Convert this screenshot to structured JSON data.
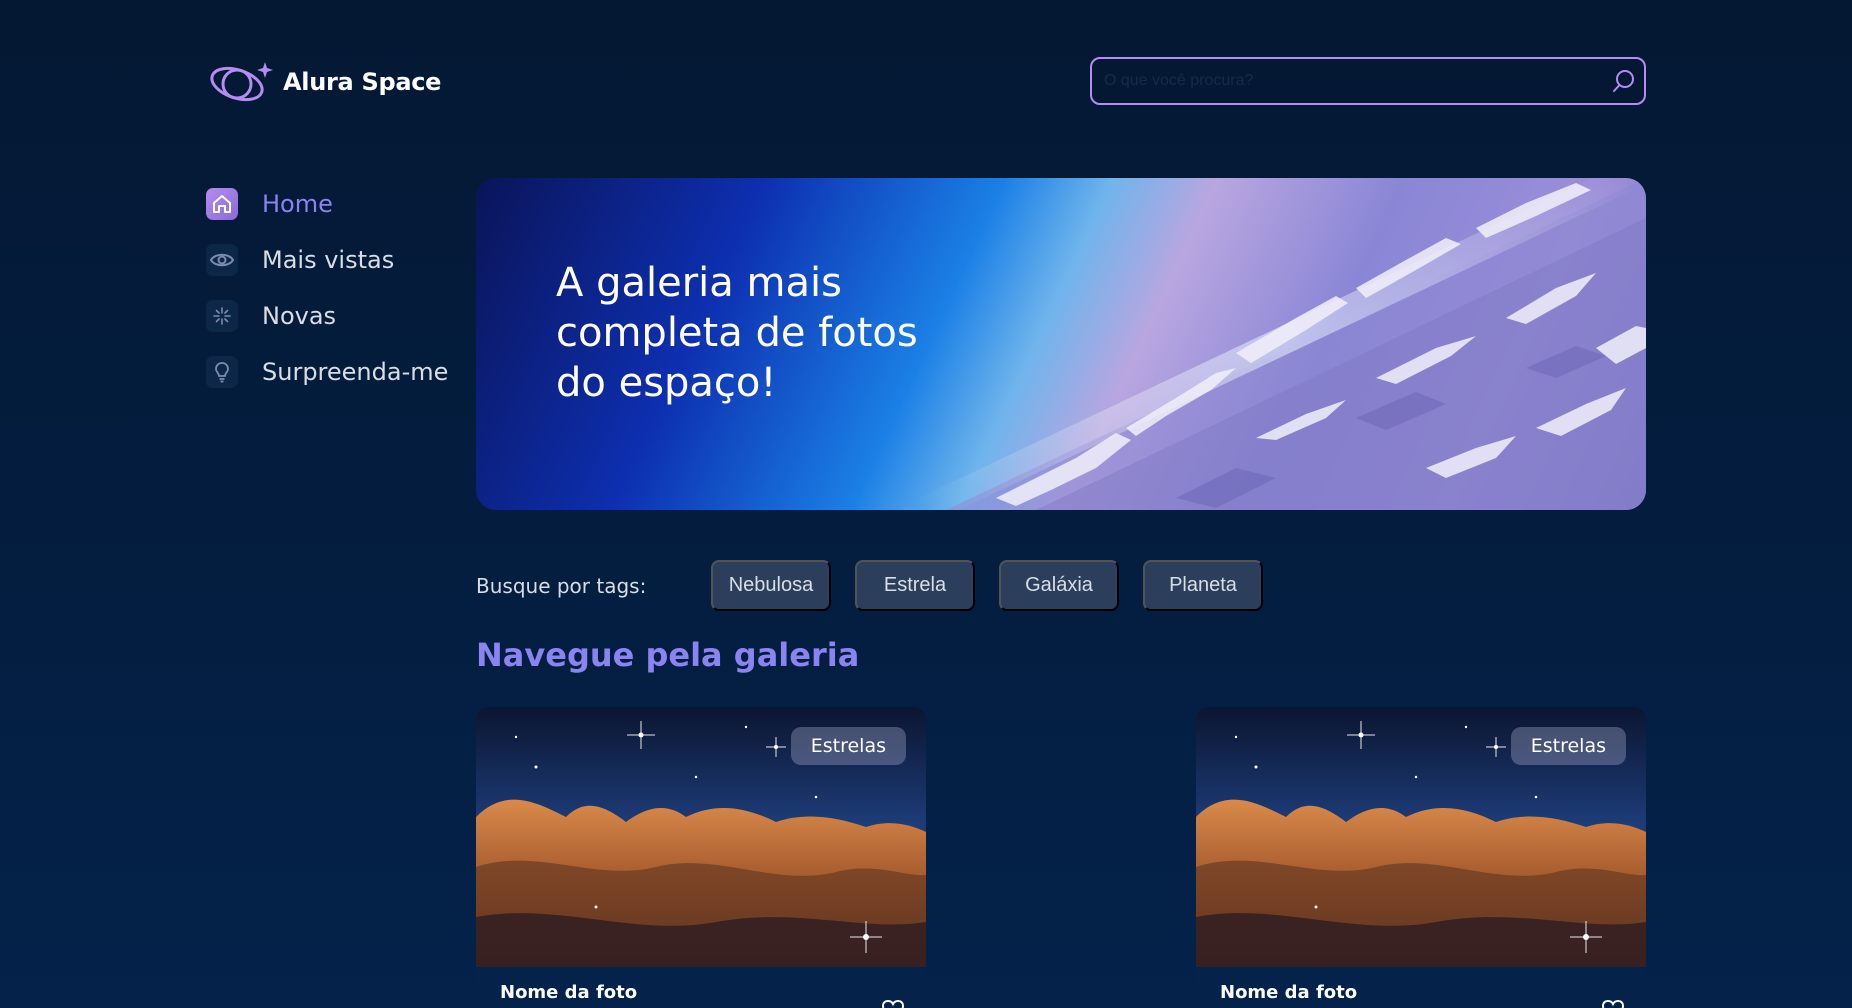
{
  "header": {
    "logo_text": "Alura Space",
    "search_placeholder": "O que você procura?"
  },
  "sidebar": {
    "items": [
      {
        "label": "Home",
        "icon": "home-icon",
        "active": true
      },
      {
        "label": "Mais vistas",
        "icon": "eye-icon",
        "active": false
      },
      {
        "label": "Novas",
        "icon": "sparkle-icon",
        "active": false
      },
      {
        "label": "Surpreenda-me",
        "icon": "lightbulb-icon",
        "active": false
      }
    ]
  },
  "banner": {
    "title": "A galeria mais completa de fotos do espaço!"
  },
  "tags": {
    "label": "Busque por tags:",
    "items": [
      "Nebulosa",
      "Estrela",
      "Galáxia",
      "Planeta"
    ]
  },
  "gallery": {
    "title": "Navegue pela galeria",
    "cards": [
      {
        "badge": "Estrelas",
        "name": "Nome da foto"
      },
      {
        "badge": "Estrelas",
        "name": "Nome da foto"
      }
    ]
  },
  "colors": {
    "background": "#041833",
    "accent": "#8a83f0",
    "search_border": "#b48cf2",
    "tag_bg": "#2b3f5c"
  }
}
